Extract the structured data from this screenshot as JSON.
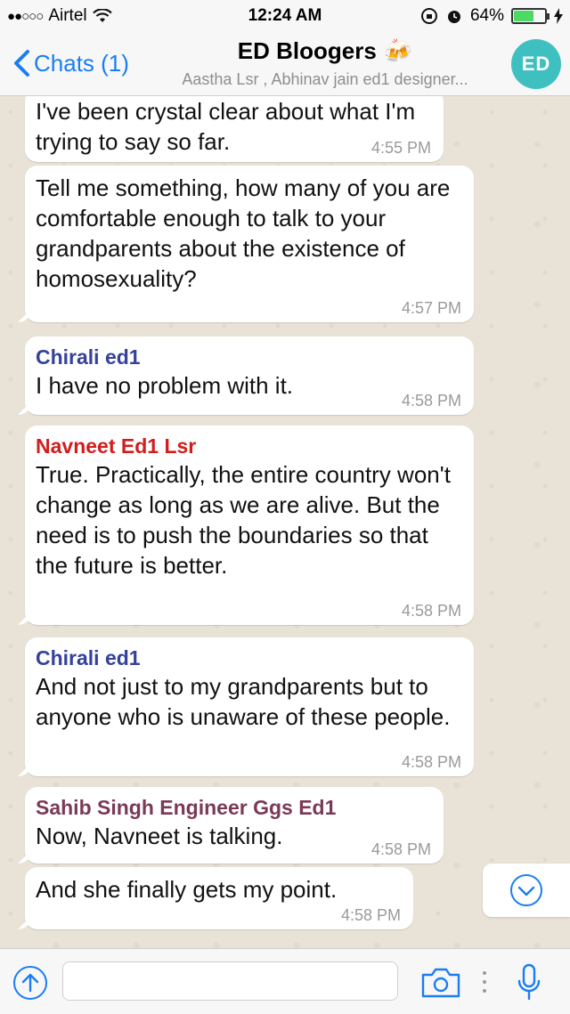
{
  "status_bar": {
    "carrier": "Airtel",
    "signal": "●●○○○",
    "time": "12:24 AM",
    "battery_percent": "64%",
    "battery_level": 0.64
  },
  "nav": {
    "back_label": "Chats (1)",
    "title": "ED Bloogers",
    "title_emoji": "🍻",
    "subtitle": "Aastha Lsr , Abhinav jain ed1 designer...",
    "avatar_text": "ED"
  },
  "messages": [
    {
      "sender": "",
      "text": "I've been crystal clear about what I'm trying to say so far.",
      "time": "4:55 PM"
    },
    {
      "sender": "",
      "text": "Tell me something, how many of you are comfortable enough to talk to your grandparents about the existence of homosexuality?",
      "time": "4:57 PM"
    },
    {
      "sender": "Chirali ed1",
      "text": "I have no problem with it.",
      "time": "4:58 PM"
    },
    {
      "sender": "Navneet Ed1 Lsr",
      "text": "True. Practically, the entire country won't change as long as we are alive. But the need is to push the boundaries so that the future is better.",
      "time": "4:58 PM"
    },
    {
      "sender": "Chirali ed1",
      "text": "And not just to my grandparents but to anyone who is unaware of these people.",
      "time": "4:58 PM"
    },
    {
      "sender": "Sahib Singh Engineer Ggs Ed1",
      "text": "Now, Navneet is talking.",
      "time": "4:58 PM"
    },
    {
      "sender": "",
      "text": "And she finally gets my point.",
      "time": "4:58 PM"
    }
  ],
  "input": {
    "placeholder": ""
  },
  "colors": {
    "accent": "#1a7ef2",
    "sender_chirali": "#35419b",
    "sender_navneet": "#d21d1d",
    "sender_sahib": "#7b3a54"
  }
}
